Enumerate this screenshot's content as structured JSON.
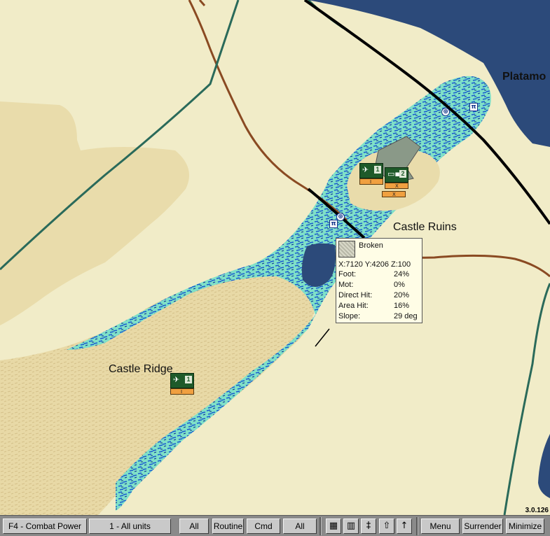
{
  "map": {
    "labels": {
      "platamon": "Platamo",
      "castle_ruins": "Castle Ruins",
      "castle_ridge": "Castle Ridge"
    },
    "version": "3.0.126",
    "colors": {
      "background": "#f1ecc8",
      "sea": "#2c4a7a",
      "dune": "#e9dcab",
      "road_dirt": "#8a4a22",
      "rail": "#000000",
      "river": "#2a6a5a",
      "broken_blue": "#1a5ad0",
      "broken_cyan": "#7fe0c8"
    }
  },
  "units": [
    {
      "id": "unit-a",
      "icon": "infantry-icon",
      "number": "1",
      "size": "I"
    },
    {
      "id": "unit-b",
      "icon": "hq-icon",
      "number": "2",
      "size": "X"
    },
    {
      "id": "unit-c",
      "icon": "infantry-icon",
      "number": "1",
      "size": "I"
    }
  ],
  "tooltip": {
    "terrain": "Broken",
    "coords": "X:7120  Y:4206  Z:100",
    "rows": [
      {
        "label": "Foot:",
        "value": "24%"
      },
      {
        "label": "Mot:",
        "value": "0%"
      },
      {
        "label": "Direct Hit:",
        "value": "20%"
      },
      {
        "label": "Area Hit:",
        "value": "16%"
      },
      {
        "label": "Slope:",
        "value": "29 deg"
      }
    ]
  },
  "toolbar": {
    "combat_power": "F4 - Combat Power",
    "units_filter": "1 - All units",
    "all_1": "All",
    "routine": "Routine",
    "cmd": "Cmd",
    "all_2": "All",
    "menu": "Menu",
    "surrender": "Surrender",
    "minimize": "Minimize",
    "icons": [
      "grid-icon",
      "unit-display-icon",
      "terrain-info-icon",
      "objective-up-icon",
      "arrow-up-icon"
    ]
  }
}
